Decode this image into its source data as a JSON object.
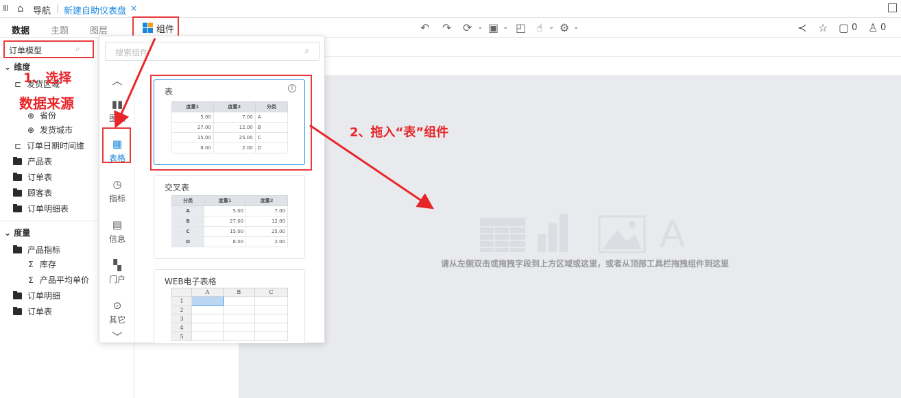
{
  "topbar": {
    "nav_label": "导航",
    "tab_title": "新建自助仪表盘",
    "close": "×"
  },
  "left_tabs": [
    "数据",
    "主题",
    "图层"
  ],
  "component_button": "组件",
  "toolbar": {
    "share_label": "",
    "like_count": "0",
    "comment_count": "0"
  },
  "left_panel": {
    "model_value": "订单模型",
    "dimension_header": "维度",
    "dimension_items": [
      "发货区域",
      "省份",
      "发货城市",
      "订单日期时间维",
      "产品表",
      "订单表",
      "顾客表",
      "订单明细表"
    ],
    "measure_header": "度量",
    "measure_items": [
      "产品指标",
      "库存",
      "产品平均单价",
      "订单明细",
      "订单表"
    ]
  },
  "annotations": {
    "step1_line1": "1、选择",
    "step1_line2": "数据来源",
    "step2": "2、拖入“表”组件"
  },
  "canvas": {
    "placeholder": "请从左侧双击或拖拽字段到上方区域或这里，或者从顶部工具栏拖拽组件到这里"
  },
  "popup": {
    "search_placeholder": "搜索组件",
    "categories": [
      "图表",
      "表格",
      "指标",
      "信息",
      "门户",
      "其它"
    ],
    "cards": [
      {
        "title": "表",
        "headers": [
          "度量1",
          "度量2",
          "分类"
        ],
        "rows": [
          [
            "5.00",
            "7.00",
            "A"
          ],
          [
            "27.00",
            "12.00",
            "B"
          ],
          [
            "15.00",
            "25.00",
            "C"
          ],
          [
            "8.00",
            "2.00",
            "D"
          ]
        ]
      },
      {
        "title": "交叉表",
        "headers": [
          "分类",
          "度量1",
          "度量2"
        ],
        "rows": [
          [
            "A",
            "5.00",
            "7.00"
          ],
          [
            "B",
            "27.00",
            "12.00"
          ],
          [
            "C",
            "15.00",
            "25.00"
          ],
          [
            "D",
            "8.00",
            "2.00"
          ]
        ]
      },
      {
        "title": "WEB电子表格",
        "columns": [
          "A",
          "B",
          "C"
        ],
        "row_numbers": [
          "1",
          "2",
          "3",
          "4",
          "5"
        ]
      }
    ]
  },
  "colors": {
    "accent": "#1a88e0",
    "annotation": "#e8262a",
    "canvas_bg": "#e8eaed"
  }
}
